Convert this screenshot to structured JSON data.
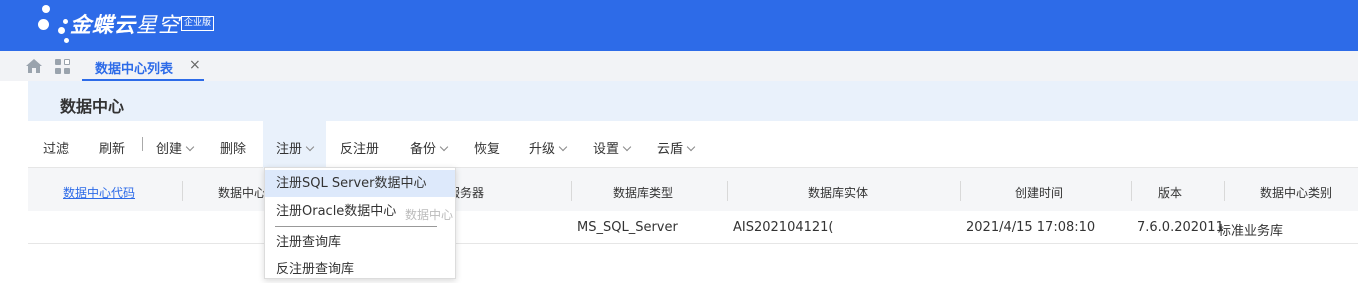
{
  "brand": {
    "name_bold": "金蝶云",
    "name_light": "星空",
    "badge": "企业版"
  },
  "tabs": [
    {
      "label": "数据中心列表",
      "close": "×"
    }
  ],
  "page": {
    "title": "数据中心"
  },
  "toolbar": {
    "filter": "过滤",
    "refresh": "刷新",
    "create": "创建",
    "delete": "删除",
    "register": "注册",
    "unregister": "反注册",
    "backup": "备份",
    "restore": "恢复",
    "upgrade": "升级",
    "settings": "设置",
    "cloud_shield": "云盾"
  },
  "table": {
    "headers": [
      "数据中心代码",
      "数据中心",
      "服务器",
      "数据库类型",
      "数据库实体",
      "创建时间",
      "版本",
      "数据中心类别"
    ],
    "rows": [
      {
        "code": "",
        "name": "",
        "server": "",
        "db_type": "MS_SQL_Server",
        "db_entity": "AIS202104121(",
        "created": "2021/4/15 17:08:10",
        "version": "7.6.0.202011",
        "category": "标准业务库"
      }
    ]
  },
  "register_menu": {
    "items": [
      "注册SQL Server数据中心",
      "注册Oracle数据中心",
      "注册查询库",
      "反注册查询库"
    ],
    "ghost_text": "数据中心"
  }
}
